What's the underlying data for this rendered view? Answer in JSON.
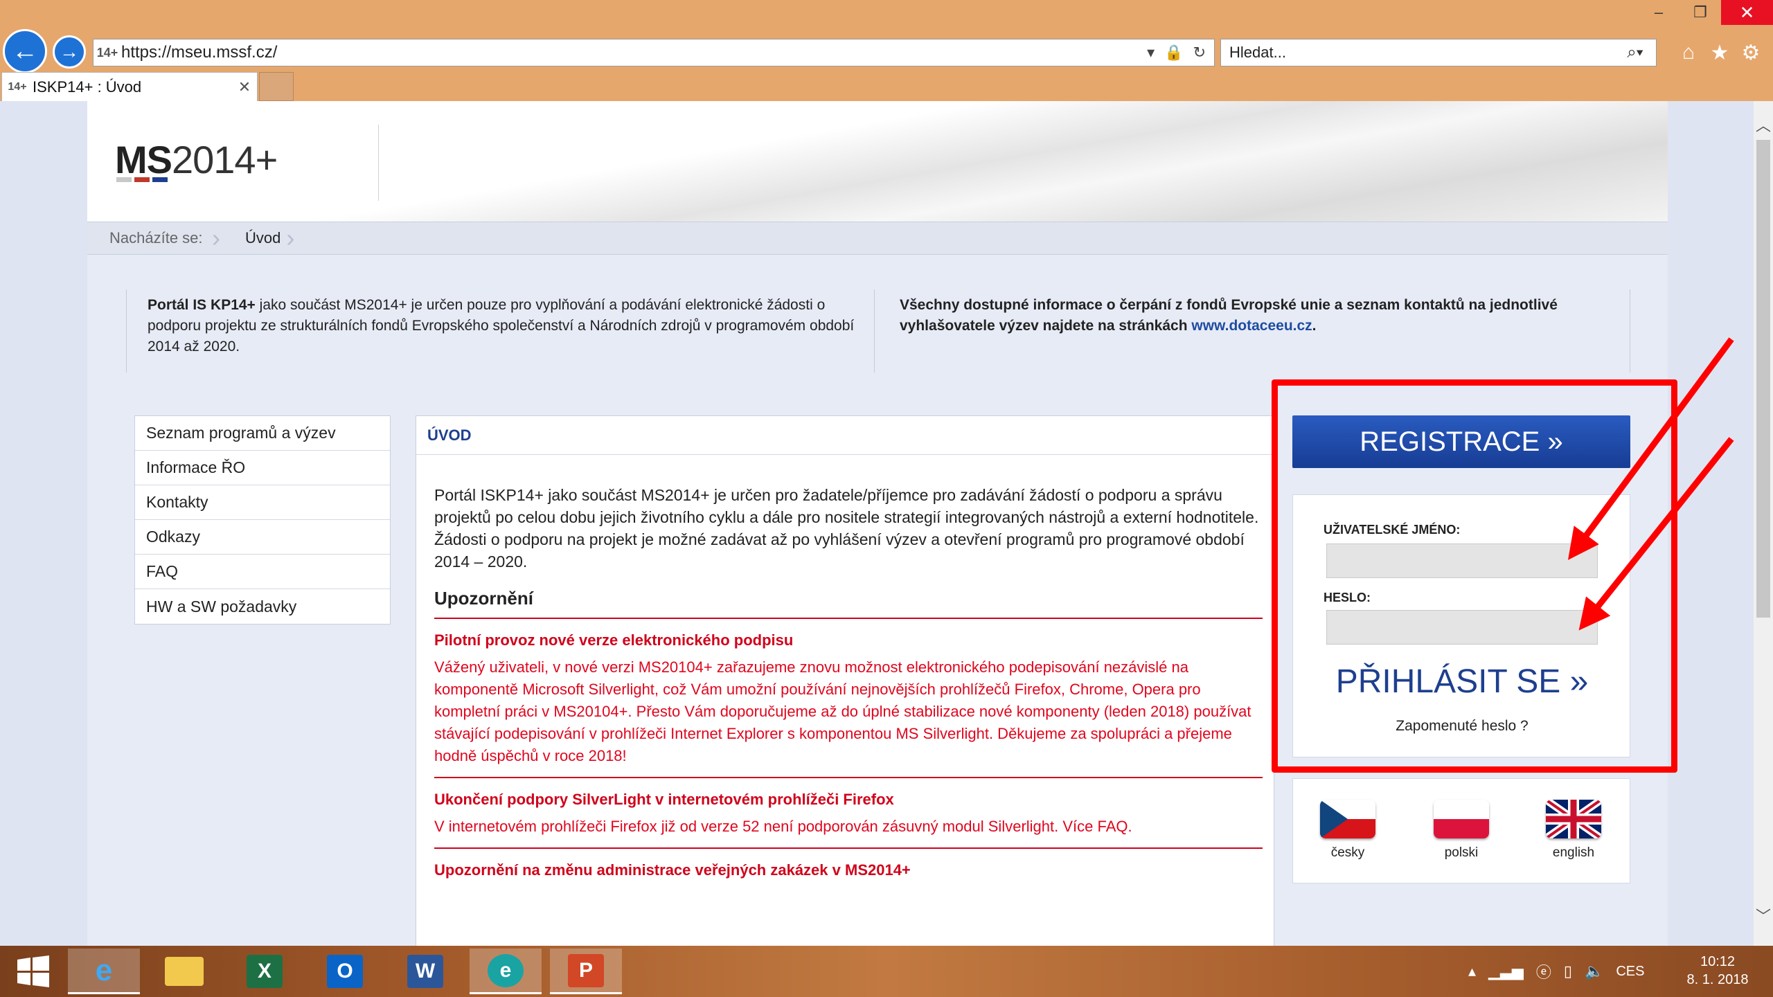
{
  "browser": {
    "url": "https://mseu.mssf.cz/",
    "favicon_label": "14+",
    "search_placeholder": "Hledat...",
    "tab_title": "ISKP14+ : Úvod",
    "window_controls": {
      "minimize": "–",
      "maximize": "❐",
      "close": "✕"
    },
    "icons": [
      "back-arrow-icon",
      "forward-arrow-icon",
      "lock-icon",
      "refresh-icon",
      "search-icon",
      "home-icon",
      "star-icon",
      "gear-icon"
    ]
  },
  "header": {
    "logo_bold": "MS",
    "logo_rest": "2014+",
    "logo_colors": [
      "#c8c8c8",
      "#c0392b",
      "#1e3f8f"
    ]
  },
  "breadcrumb": {
    "label": "Nacházíte se:",
    "current": "Úvod"
  },
  "intro": {
    "left_bold": "Portál IS KP14+",
    "left_text": " jako součást MS2014+ je určen pouze pro vyplňování a podávání elektronické žádosti o podporu projektu ze strukturálních fondů Evropského společenství a Národních zdrojů v programovém období 2014 až 2020.",
    "right_text": "Všechny dostupné informace o čerpání z fondů Evropské unie a seznam kontaktů na jednotlivé vyhlašovatele výzev najdete na stránkách ",
    "right_link": "www.dotaceeu.cz",
    "right_after": "."
  },
  "menu": [
    "Seznam programů a výzev",
    "Informace ŘO",
    "Kontakty",
    "Odkazy",
    "FAQ",
    "HW a SW požadavky"
  ],
  "content": {
    "title": "ÚVOD",
    "intro": "Portál ISKP14+ jako součást MS2014+ je určen pro žadatele/příjemce pro zadávání žádostí o podporu a správu projektů po celou dobu jejich životního cyklu a dále pro nositele strategií integrovaných nástrojů a externí hodnotitele. Žádosti o podporu na projekt je možné zadávat až po vyhlášení výzev a otevření programů pro programové období 2014 – 2020.",
    "notice_heading": "Upozornění",
    "news": [
      {
        "title": "Pilotní provoz nové verze elektronického podpisu",
        "text": "Vážený uživateli, v nové verzi MS20104+ zařazujeme znovu možnost elektronického podepisování nezávislé na komponentě Microsoft Silverlight, což Vám umožní používání nejnovějších prohlížečů Firefox, Chrome, Opera pro kompletní práci v MS20104+. Přesto Vám doporučujeme až do úplné stabilizace nové komponenty (leden 2018) používat stávající podepisování v prohlížeči Internet Explorer s komponentou MS Silverlight. Děkujeme za spolupráci a přejeme hodně úspěchů v roce 2018!"
      },
      {
        "title": "Ukončení podpory SilverLight v internetovém prohlížeči Firefox",
        "text": "V internetovém prohlížeči Firefox již od verze 52 není podporován zásuvný modul Silverlight. Více FAQ."
      },
      {
        "title": "Upozornění na změnu administrace veřejných zakázek v MS2014+",
        "text": ""
      }
    ]
  },
  "login": {
    "register_label": "REGISTRACE »",
    "username_label": "UŽIVATELSKÉ JMÉNO:",
    "username_value": "",
    "password_label": "HESLO:",
    "password_value": "",
    "login_label": "PŘIHLÁSIT SE »",
    "forgot_label": "Zapomenuté heslo ?"
  },
  "languages": [
    {
      "label": "česky",
      "icon": "czech-flag-icon"
    },
    {
      "label": "polski",
      "icon": "polish-flag-icon"
    },
    {
      "label": "english",
      "icon": "uk-flag-icon"
    }
  ],
  "taskbar": {
    "apps": [
      "start-icon",
      "internet-explorer-icon",
      "file-explorer-icon",
      "excel-icon",
      "outlook-icon",
      "word-icon",
      "edge-icon",
      "powerpoint-icon"
    ],
    "language": "CES",
    "time": "10:12",
    "date": "8. 1. 2018"
  },
  "colors": {
    "accent_blue": "#1e3f8f",
    "alert_red": "#d0021b",
    "annotation_red": "#ff0000"
  }
}
